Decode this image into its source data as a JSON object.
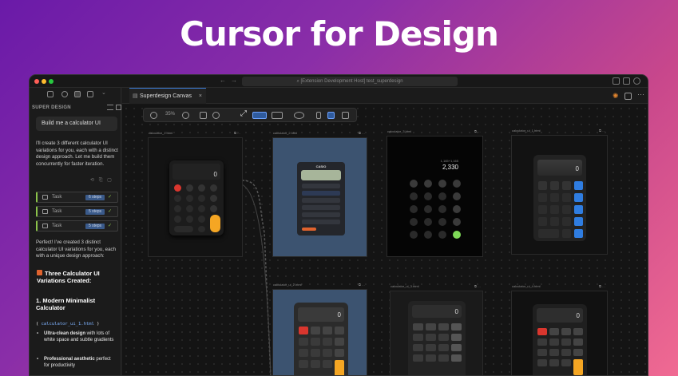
{
  "headline": "Cursor for Design",
  "titlebar": {
    "search": "[Extension Development Host] test_superdesign"
  },
  "sidebar": {
    "title": "SUPER DESIGN",
    "prompt": "Build me a calculator UI",
    "reply": "I'll create 3 different calculator UI variations for you, each with a distinct design approach. Let me build them concurrently for faster iteration.",
    "tasks": [
      {
        "label": "Task",
        "badge": "6 steps"
      },
      {
        "label": "Task",
        "badge": "5 steps"
      },
      {
        "label": "Task",
        "badge": "5 steps"
      }
    ],
    "summary": "Perfect! I've created 3 distinct calculator UI variations for you, each with a unique design approach:",
    "heading": "Three Calculator UI Variations Created:",
    "item1_title": "1. Modern Minimalist Calculator",
    "item1_file": "calculator_ui_1.html",
    "bullets": [
      {
        "bold": "Ultra-clean design",
        "rest": " with lots of white space and subtle gradients"
      },
      {
        "bold": "Professional aesthetic",
        "rest": " perfect for productivity"
      }
    ]
  },
  "main": {
    "tab_label": "Superdesign Canvas",
    "zoom": "35%"
  },
  "frames": {
    "f1": "calculator_1.html",
    "f2": "calculator_2.html",
    "f3": "calculator_3.html",
    "f4": "calculator_ui_1.html",
    "f5": "calculator_ui_2.html",
    "f6": "calculator_ui_3.html",
    "f7": "calculator_ui_4.html"
  },
  "calcs": {
    "c1_display": "0",
    "c2_brand": "CASIO",
    "c3_expr": "1,165+1,165",
    "c3_display": "2,330",
    "c4_display": "0",
    "c5_display": "0",
    "c6_display": "0",
    "c7_display": "0"
  },
  "colors": {
    "accent": "#3b7bd6",
    "task_bar": "#8bc34a"
  }
}
